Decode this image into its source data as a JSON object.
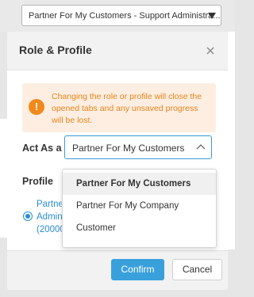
{
  "topbar": {
    "select_value": "Partner For My Customers - Support Administra..."
  },
  "modal": {
    "title": "Role & Profile",
    "warning": "Changing the role or profile will close the opened tabs and any unsaved progress will be lost.",
    "act_as_label": "Act As a",
    "act_as_value": "Partner For My Customers",
    "profile_label": "Profile",
    "profile_lines": [
      "Partne",
      "Admin",
      "(20000"
    ],
    "options": [
      {
        "label": "Partner For My Customers",
        "selected": true
      },
      {
        "label": "Partner For My Company",
        "selected": false
      },
      {
        "label": "Customer",
        "selected": false
      }
    ],
    "confirm_label": "Confirm",
    "cancel_label": "Cancel"
  },
  "colors": {
    "accent": "#3aa0dc",
    "warning_bg": "#fdeee1",
    "warning_text": "#e8841c"
  }
}
